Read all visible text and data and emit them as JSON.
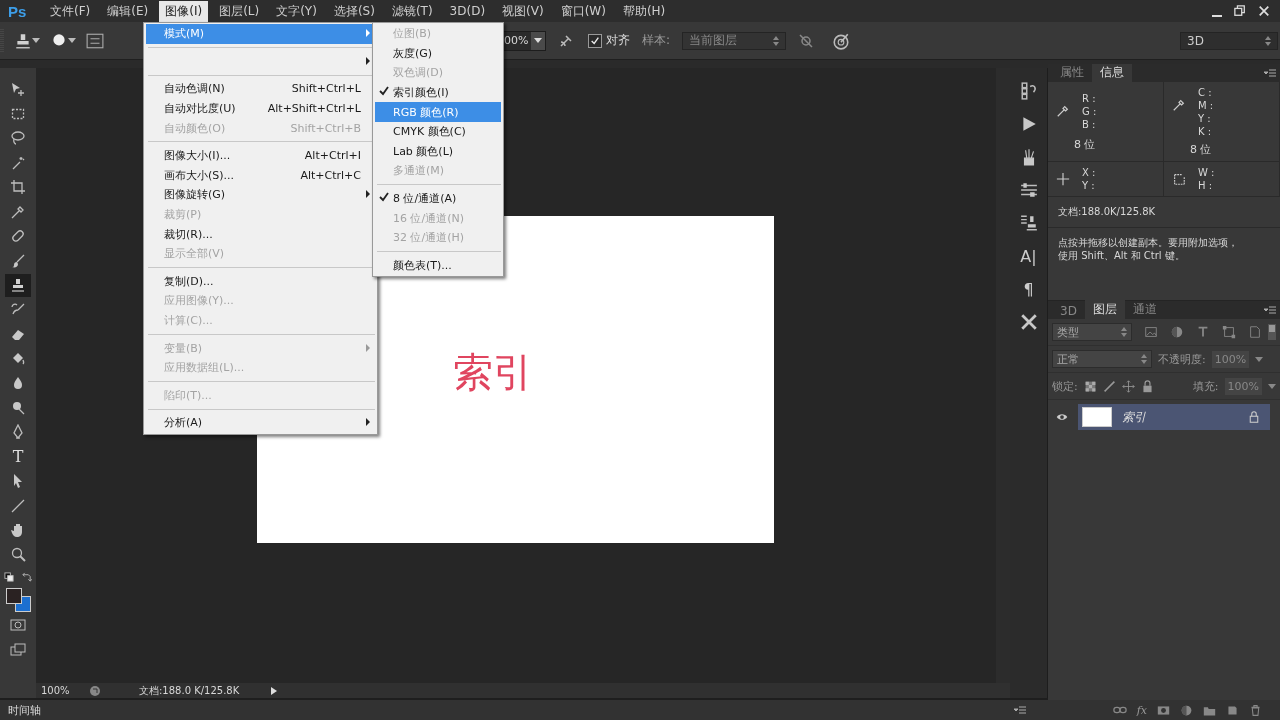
{
  "app_logo": "Ps",
  "menubar": [
    {
      "label": "文件(F)",
      "selected": false
    },
    {
      "label": "编辑(E)",
      "selected": false
    },
    {
      "label": "图像(I)",
      "selected": true
    },
    {
      "label": "图层(L)",
      "selected": false
    },
    {
      "label": "文字(Y)",
      "selected": false
    },
    {
      "label": "选择(S)",
      "selected": false
    },
    {
      "label": "滤镜(T)",
      "selected": false
    },
    {
      "label": "3D(D)",
      "selected": false
    },
    {
      "label": "视图(V)",
      "selected": false
    },
    {
      "label": "窗口(W)",
      "selected": false
    },
    {
      "label": "帮助(H)",
      "selected": false
    }
  ],
  "options_bar": {
    "percent": "00%",
    "align": {
      "label": "对齐",
      "checked": true
    },
    "sample_label": "样本:",
    "sample_value": "当前图层",
    "workspace": "3D"
  },
  "image_menu": [
    {
      "kind": "item",
      "label": "模式(M)",
      "submenu": true,
      "disabled": false,
      "selected": true
    },
    {
      "kind": "separator"
    },
    {
      "kind": "item",
      "submenu": true,
      "disabled": false,
      "selected": false
    },
    {
      "kind": "separator"
    },
    {
      "kind": "item",
      "label": "自动色调(N)",
      "shortcut": "Shift+Ctrl+L",
      "disabled": false,
      "selected": false
    },
    {
      "kind": "item",
      "label": "自动对比度(U)",
      "shortcut": "Alt+Shift+Ctrl+L",
      "disabled": false,
      "selected": false
    },
    {
      "kind": "item",
      "label": "自动颜色(O)",
      "shortcut": "Shift+Ctrl+B",
      "disabled": true,
      "selected": false
    },
    {
      "kind": "separator"
    },
    {
      "kind": "item",
      "label": "图像大小(I)...",
      "shortcut": "Alt+Ctrl+I",
      "disabled": false,
      "selected": false
    },
    {
      "kind": "item",
      "label": "画布大小(S)...",
      "shortcut": "Alt+Ctrl+C",
      "disabled": false,
      "selected": false
    },
    {
      "kind": "item",
      "label": "图像旋转(G)",
      "submenu": true,
      "disabled": false,
      "selected": false
    },
    {
      "kind": "item",
      "label": "裁剪(P)",
      "disabled": true,
      "selected": false
    },
    {
      "kind": "item",
      "label": "裁切(R)...",
      "disabled": false,
      "selected": false
    },
    {
      "kind": "item",
      "label": "显示全部(V)",
      "disabled": true,
      "selected": false
    },
    {
      "kind": "separator"
    },
    {
      "kind": "item",
      "label": "复制(D)...",
      "disabled": false,
      "selected": false
    },
    {
      "kind": "item",
      "label": "应用图像(Y)...",
      "disabled": true,
      "selected": false
    },
    {
      "kind": "item",
      "label": "计算(C)...",
      "disabled": true,
      "selected": false
    },
    {
      "kind": "separator"
    },
    {
      "kind": "item",
      "label": "变量(B)",
      "submenu": true,
      "disabled": true,
      "selected": false
    },
    {
      "kind": "item",
      "label": "应用数据组(L)...",
      "disabled": true,
      "selected": false
    },
    {
      "kind": "separator"
    },
    {
      "kind": "item",
      "label": "陷印(T)...",
      "disabled": true,
      "selected": false
    },
    {
      "kind": "separator"
    },
    {
      "kind": "item",
      "label": "分析(A)",
      "submenu": true,
      "disabled": false,
      "selected": false
    }
  ],
  "mode_submenu": [
    {
      "kind": "item",
      "label": "位图(B)",
      "disabled": true,
      "checked": false,
      "selected": false
    },
    {
      "kind": "item",
      "label": "灰度(G)",
      "disabled": false,
      "checked": false,
      "selected": false
    },
    {
      "kind": "item",
      "label": "双色调(D)",
      "disabled": true,
      "checked": false,
      "selected": false
    },
    {
      "kind": "item",
      "label": "索引颜色(I)",
      "disabled": false,
      "checked": true,
      "selected": false
    },
    {
      "kind": "item",
      "label": "RGB 颜色(R)",
      "disabled": false,
      "checked": false,
      "selected": true
    },
    {
      "kind": "item",
      "label": "CMYK 颜色(C)",
      "disabled": false,
      "checked": false,
      "selected": false
    },
    {
      "kind": "item",
      "label": "Lab 颜色(L)",
      "disabled": false,
      "checked": false,
      "selected": false
    },
    {
      "kind": "item",
      "label": "多通道(M)",
      "disabled": true,
      "checked": false,
      "selected": false
    },
    {
      "kind": "separator"
    },
    {
      "kind": "item",
      "label": "8 位/通道(A)",
      "disabled": false,
      "checked": true,
      "selected": false
    },
    {
      "kind": "item",
      "label": "16 位/通道(N)",
      "disabled": true,
      "checked": false,
      "selected": false
    },
    {
      "kind": "item",
      "label": "32 位/通道(H)",
      "disabled": true,
      "checked": false,
      "selected": false
    },
    {
      "kind": "separator"
    },
    {
      "kind": "item",
      "label": "颜色表(T)...",
      "disabled": false,
      "checked": false,
      "selected": false
    }
  ],
  "tools": [
    {
      "kind": "move",
      "selected": false
    },
    {
      "kind": "marquee",
      "selected": false
    },
    {
      "kind": "lasso",
      "selected": false
    },
    {
      "kind": "wand",
      "selected": false
    },
    {
      "kind": "crop",
      "selected": false
    },
    {
      "kind": "eyedropper",
      "selected": false
    },
    {
      "kind": "healing",
      "selected": false
    },
    {
      "kind": "brush",
      "selected": false
    },
    {
      "kind": "stamp",
      "selected": true
    },
    {
      "kind": "history",
      "selected": false
    },
    {
      "kind": "eraser",
      "selected": false
    },
    {
      "kind": "bucket",
      "selected": false
    },
    {
      "kind": "blur",
      "selected": false
    },
    {
      "kind": "dodge",
      "selected": false
    },
    {
      "kind": "pen",
      "selected": false
    },
    {
      "kind": "type",
      "glyph": "T",
      "selected": false
    },
    {
      "kind": "pathselect",
      "selected": false
    },
    {
      "kind": "line",
      "selected": false
    },
    {
      "kind": "hand",
      "selected": false
    },
    {
      "kind": "zoom",
      "selected": false
    }
  ],
  "canvas_text": "索引",
  "dock": [
    {
      "kind": "history"
    },
    {
      "kind": "actions"
    },
    {
      "kind": "brushes"
    },
    {
      "kind": "adjust"
    },
    {
      "kind": "clone"
    },
    {
      "kind": "glyph",
      "glyph": "A|"
    },
    {
      "kind": "glyph",
      "glyph": "¶"
    },
    {
      "kind": "tools"
    }
  ],
  "info_panel": {
    "tabs": [
      {
        "label": "属性",
        "selected": false
      },
      {
        "label": "信息",
        "selected": true
      }
    ],
    "rgb": [
      "R :",
      "G :",
      "B :"
    ],
    "rgb_depth": "8 位",
    "cmyk": [
      "C :",
      "M :",
      "Y :",
      "K :"
    ],
    "cmyk_depth": "8 位",
    "xy": [
      "X :",
      "Y :"
    ],
    "wh": [
      "W :",
      "H :"
    ],
    "document": "文档:188.0K/125.8K",
    "tip": [
      "点按并拖移以创建副本。要用附加选项，",
      "使用 Shift、Alt 和 Ctrl 键。"
    ]
  },
  "layers_panel": {
    "tabs": [
      {
        "label": "3D",
        "selected": false
      },
      {
        "label": "图层",
        "selected": true
      },
      {
        "label": "通道",
        "selected": false
      }
    ],
    "filter": "类型",
    "blend_mode": "正常",
    "opacity_label": "不透明度:",
    "opacity": "100%",
    "lock_label": "锁定:",
    "fill_label": "填充:",
    "fill": "100%",
    "layers": [
      {
        "name": "索引",
        "selected": true,
        "visible": true,
        "locked": true
      }
    ],
    "footer_fx": "fx"
  },
  "status_bar": {
    "zoom": "100%",
    "document": "文档:188.0 K/125.8K"
  },
  "timeline": "时间轴"
}
